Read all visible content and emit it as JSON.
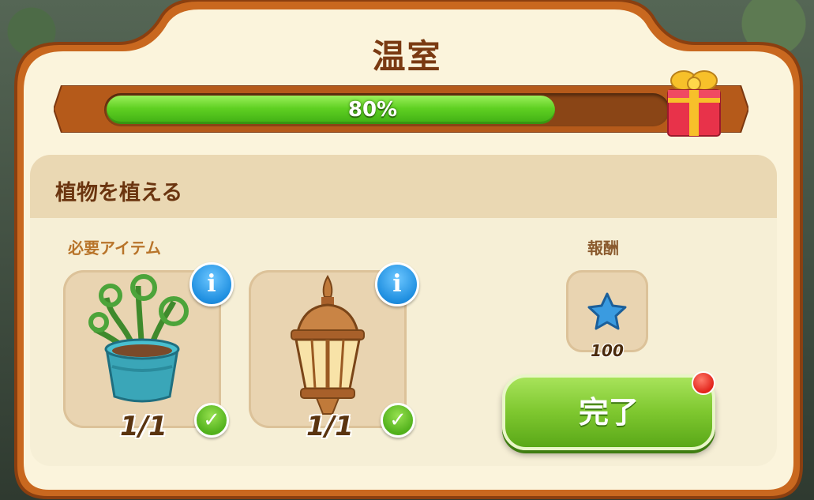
{
  "window": {
    "title": "温室"
  },
  "progress": {
    "percent": 80,
    "label": "80%"
  },
  "section": {
    "title": "植物を植える"
  },
  "requirements": {
    "label": "必要アイテム",
    "items": [
      {
        "name": "fern-pot",
        "icon": "potted-fern-icon",
        "count": "1/1",
        "complete": true
      },
      {
        "name": "lantern",
        "icon": "lantern-icon",
        "count": "1/1",
        "complete": true
      }
    ]
  },
  "reward": {
    "label": "報酬",
    "icon": "blue-star-icon",
    "value": "100"
  },
  "actions": {
    "complete_label": "完了"
  },
  "colors": {
    "title": "#7a3a12",
    "progress_fill": "#5fd022",
    "button": "#7ec72f",
    "info": "#1f8fe0",
    "notification": "#e2231a"
  }
}
